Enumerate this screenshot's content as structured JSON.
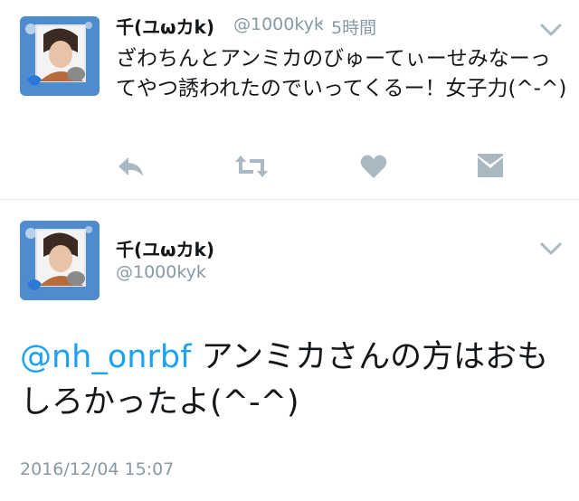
{
  "tweet1": {
    "display_name": "千(ユωカk)",
    "handle": "@1000kyk",
    "separator": "·",
    "time": "5時間",
    "text": "ざわちんとアンミカのびゅーてぃーせみなーってやつ誘われたのでいってくるー！女子力(^-^)"
  },
  "actions": {
    "reply_icon": "reply-icon",
    "retweet_icon": "retweet-icon",
    "like_icon": "heart-icon",
    "dm_icon": "envelope-icon"
  },
  "tweet2": {
    "display_name": "千(ユωカk)",
    "handle": "@1000kyk",
    "mention": "@nh_onrbf",
    "text": " アンミカさんの方はおもしろかったよ(^-^)",
    "timestamp": "2016/12/04 15:07"
  },
  "colors": {
    "link": "#1da1f2",
    "secondary": "#8899a6",
    "icon": "#aab8c2",
    "divider": "#e1e8ed"
  }
}
